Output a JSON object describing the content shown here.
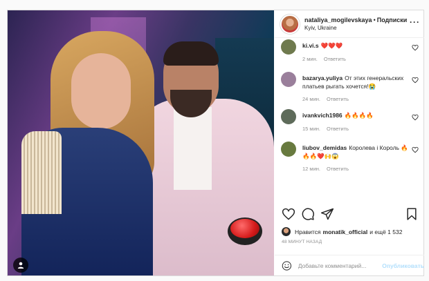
{
  "header": {
    "username": "nataliya_mogilevskaya",
    "dot": "•",
    "follow_label": "Подписки",
    "location": "Kyiv, Ukraine",
    "more_icon": "more-horizontal-icon"
  },
  "comments": [
    {
      "user": "ki.vi.s",
      "text": "❤️❤️❤️",
      "time": "2 мин.",
      "reply": "Ответить",
      "avatar_color": "#6f7a4e"
    },
    {
      "user": "bazarya.yuliya",
      "text": "От этих генеральских платьев рыгать хочется!😭",
      "time": "24 мин.",
      "reply": "Ответить",
      "avatar_color": "#9a7f9b"
    },
    {
      "user": "ivankvich1986",
      "text": "🔥🔥🔥🔥",
      "time": "15 мин.",
      "reply": "Ответить",
      "avatar_color": "#5e6b5a"
    },
    {
      "user": "liubov_demidas",
      "text": "Королева і Король 🔥🔥🔥❤️🙌😱",
      "time": "12 мин.",
      "reply": "Ответить",
      "avatar_color": "#687a3f"
    }
  ],
  "likes": {
    "prefix": "Нравится",
    "user": "monatik_official",
    "suffix": "и ещё 1 532"
  },
  "time_ago": "48 МИНУТ НАЗАД",
  "add_comment": {
    "placeholder": "Добавьте комментарий...",
    "publish_label": "Опубликовать"
  },
  "colors": {
    "border": "#dbdbdb",
    "meta_gray": "#8e8e8e",
    "publish_blue": "#b2dffc",
    "text": "#262626"
  }
}
